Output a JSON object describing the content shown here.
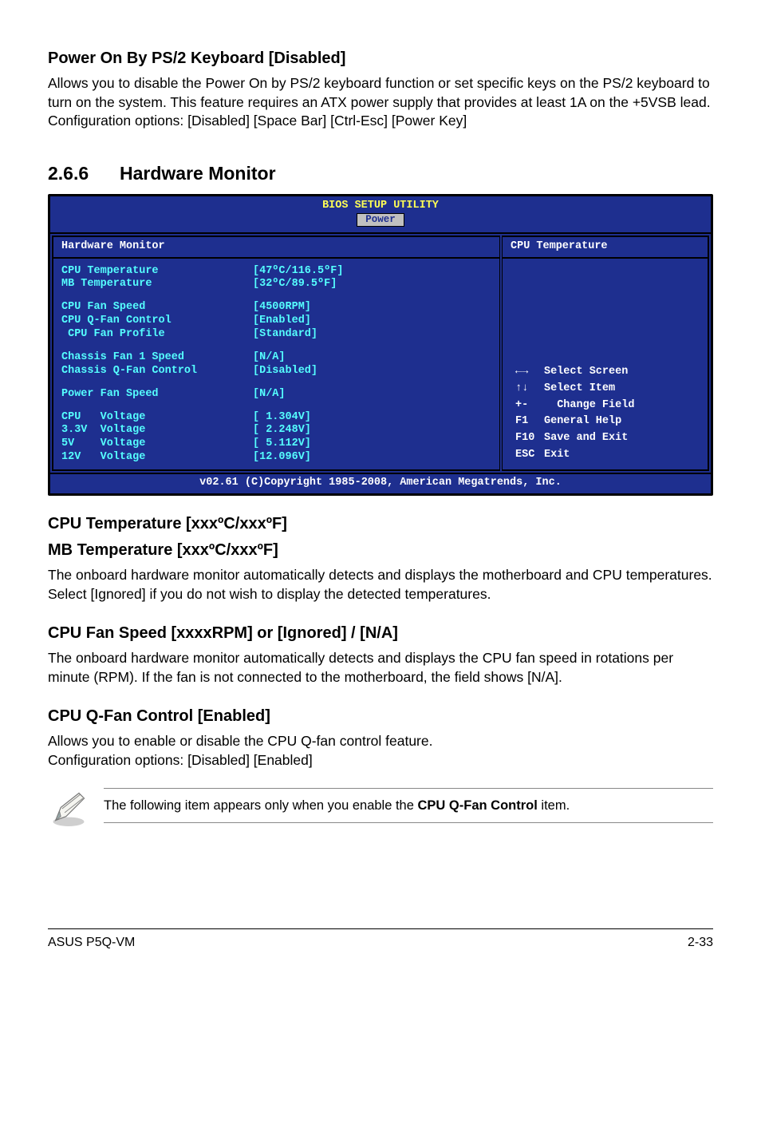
{
  "section_ps2": {
    "heading": "Power On By PS/2 Keyboard [Disabled]",
    "para1": "Allows you to disable the Power On by PS/2 keyboard function or set specific keys on the PS/2 keyboard to turn on the system. This feature requires an ATX power supply that provides at least 1A on the +5VSB lead.",
    "para2": "Configuration options: [Disabled] [Space Bar] [Ctrl-Esc] [Power Key]"
  },
  "section_hwmon": {
    "number": "2.6.6",
    "title": "Hardware Monitor"
  },
  "bios": {
    "header": "BIOS SETUP UTILITY",
    "tab": "Power",
    "left_title": "Hardware Monitor",
    "rows": [
      {
        "label": "CPU Temperature",
        "val": "[47ºC/116.5ºF]"
      },
      {
        "label": "MB Temperature",
        "val": "[32ºC/89.5ºF]"
      },
      {
        "label": "",
        "val": ""
      },
      {
        "label": "CPU Fan Speed",
        "val": "[4500RPM]"
      },
      {
        "label": "CPU Q-Fan Control",
        "val": "[Enabled]"
      },
      {
        "label": " CPU Fan Profile",
        "val": "[Standard]"
      },
      {
        "label": "",
        "val": ""
      },
      {
        "label": "Chassis Fan 1 Speed",
        "val": "[N/A]"
      },
      {
        "label": "Chassis Q-Fan Control",
        "val": "[Disabled]"
      },
      {
        "label": "",
        "val": ""
      },
      {
        "label": "Power Fan Speed",
        "val": "[N/A]"
      },
      {
        "label": "",
        "val": ""
      },
      {
        "label": "CPU   Voltage",
        "val": "[ 1.304V]"
      },
      {
        "label": "3.3V  Voltage",
        "val": "[ 2.248V]"
      },
      {
        "label": "5V    Voltage",
        "val": "[ 5.112V]"
      },
      {
        "label": "12V   Voltage",
        "val": "[12.096V]"
      }
    ],
    "right_title": "CPU Temperature",
    "help": [
      {
        "key": "←→",
        "desc": "Select Screen"
      },
      {
        "key": "↑↓",
        "desc": "Select Item"
      },
      {
        "key": "+-",
        "desc": "  Change Field"
      },
      {
        "key": "F1",
        "desc": "General Help"
      },
      {
        "key": "F10",
        "desc": "Save and Exit"
      },
      {
        "key": "ESC",
        "desc": "Exit"
      }
    ],
    "footer": "v02.61 (C)Copyright 1985-2008, American Megatrends, Inc."
  },
  "section_cputemp": {
    "heading1": "CPU Temperature [xxxºC/xxxºF]",
    "heading2": "MB Temperature [xxxºC/xxxºF]",
    "para": "The onboard hardware monitor automatically detects and displays the motherboard and CPU temperatures. Select [Ignored] if you do not wish to display the detected temperatures."
  },
  "section_fanspeed": {
    "heading": "CPU Fan Speed [xxxxRPM] or [Ignored] / [N/A]",
    "para": "The onboard hardware monitor automatically detects and displays the CPU fan speed in rotations per minute (RPM). If the fan is not connected to the motherboard, the field shows [N/A]."
  },
  "section_qfan": {
    "heading": "CPU Q-Fan Control [Enabled]",
    "para1": "Allows you to enable or disable the CPU Q-fan control feature.",
    "para2": "Configuration options: [Disabled] [Enabled]",
    "note_prefix": "The following item appears only when you enable the ",
    "note_bold": "CPU Q-Fan Control",
    "note_suffix": " item."
  },
  "footer": {
    "left": "ASUS P5Q-VM",
    "right": "2-33"
  }
}
